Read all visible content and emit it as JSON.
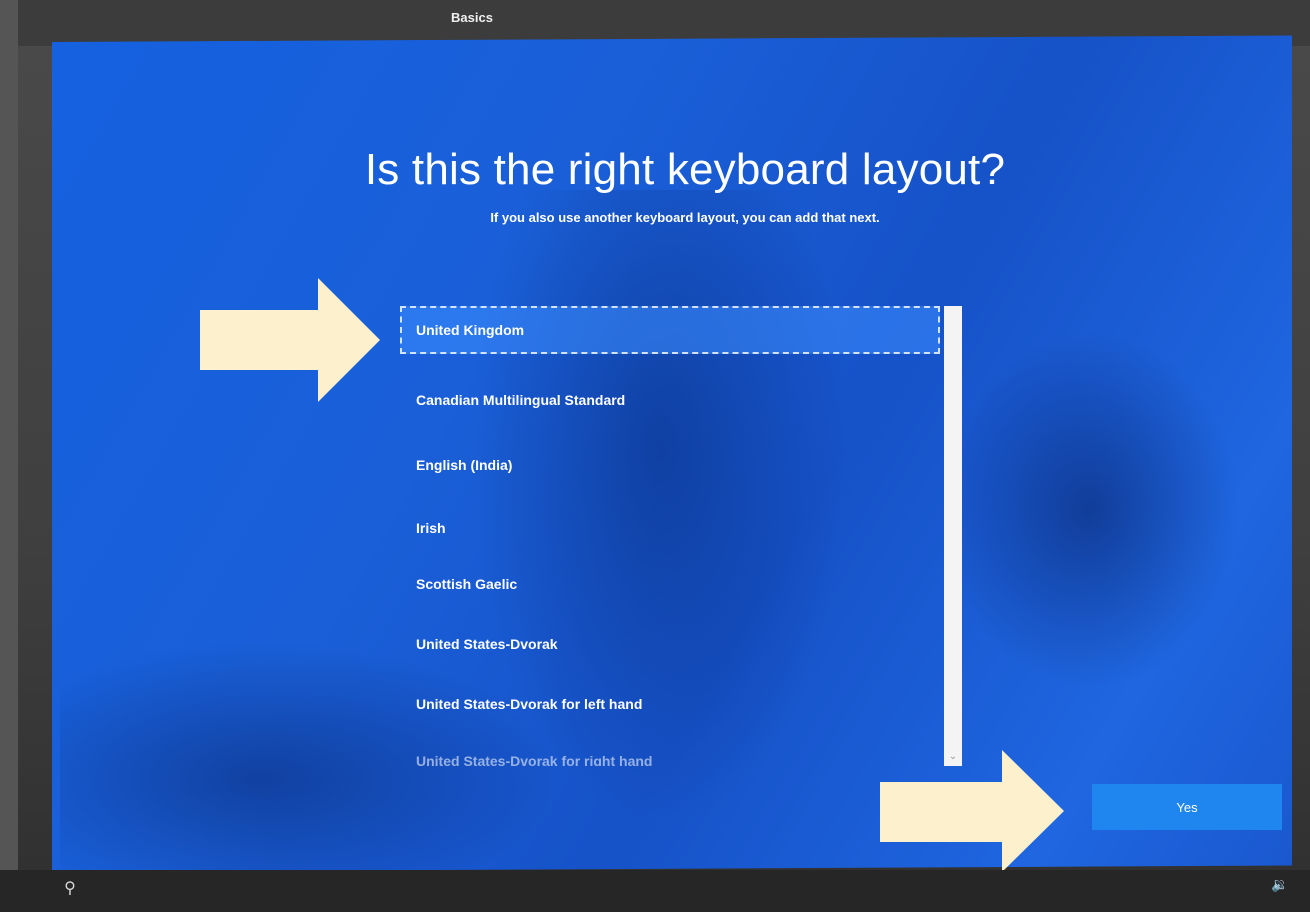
{
  "header": {
    "tab_label": "Basics"
  },
  "main": {
    "title": "Is this the right keyboard layout?",
    "subtitle": "If you also use another keyboard layout, you can add that next.",
    "layouts": [
      "United Kingdom",
      "Canadian Multilingual Standard",
      "English (India)",
      "Irish",
      "Scottish Gaelic",
      "United States-Dvorak",
      "United States-Dvorak for left hand",
      "United States-Dvorak for right hand"
    ],
    "selected_layout": "United Kingdom",
    "yes_button_label": "Yes"
  },
  "footer": {
    "ease_of_access_icon": "ease-of-access-icon",
    "volume_icon": "volume-icon"
  },
  "colors": {
    "screen_blue": "#1a5fd8",
    "selected_item": "#3c8cff",
    "button_blue": "#1f86f0",
    "annotation_arrow": "#fdf0cc"
  }
}
